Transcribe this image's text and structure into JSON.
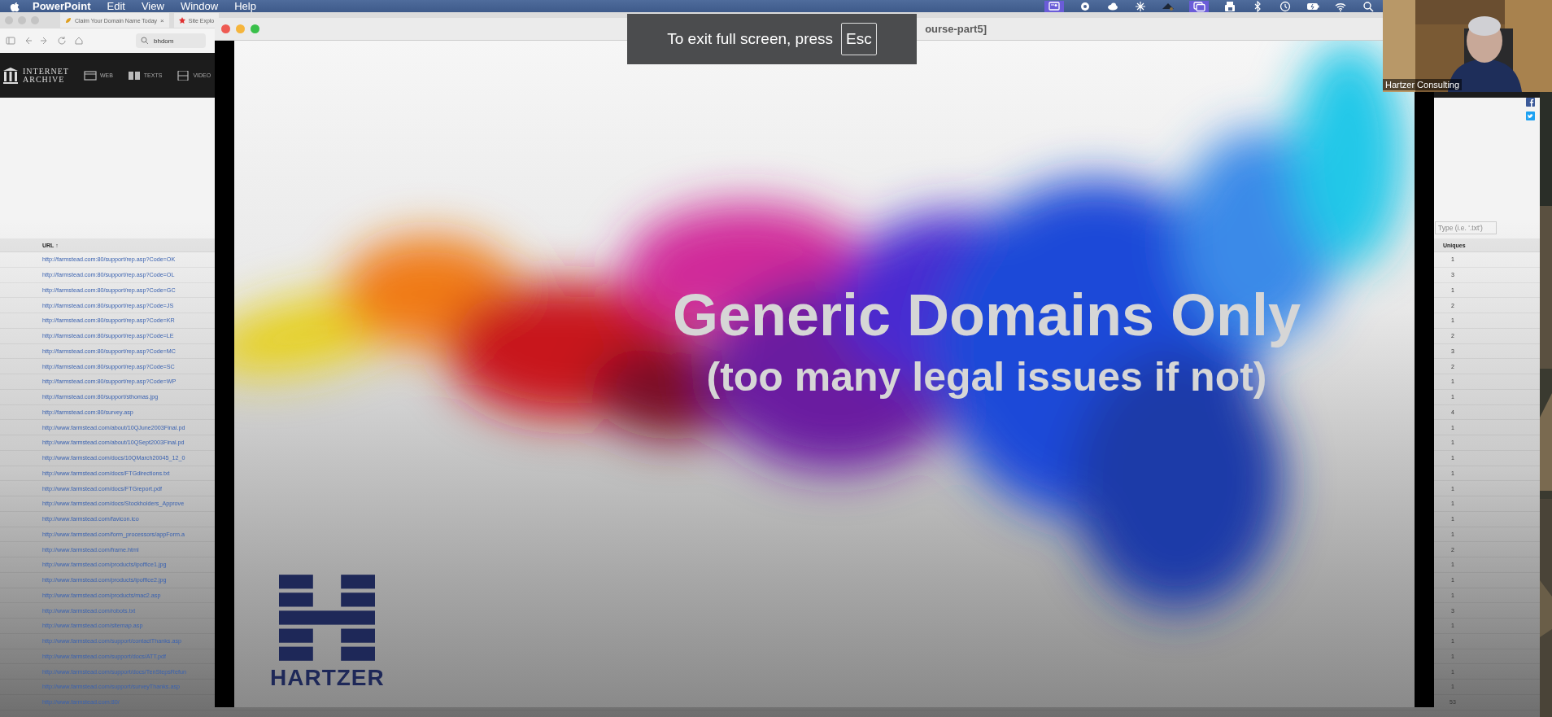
{
  "menu_bar": {
    "app": "PowerPoint",
    "items": [
      "Edit",
      "View",
      "Window",
      "Help"
    ]
  },
  "browser": {
    "tabs": [
      {
        "label": "Claim Your Domain Name Today",
        "close": "×"
      },
      {
        "label": "Site Explo"
      }
    ],
    "address": "bhdom",
    "site_header": {
      "logo_lines": [
        "INTERNET",
        "ARCHIVE"
      ],
      "links": [
        "WEB",
        "TEXTS",
        "VIDEO"
      ]
    },
    "filter_field": {
      "placeholder": "Type (i.e. '.txt')"
    },
    "table": {
      "columns": [
        "URL ↑",
        "Uniques"
      ],
      "rows": [
        {
          "url": "http://farmstead.com:80/support/rep.asp?Code=OK",
          "uniques": "1"
        },
        {
          "url": "http://farmstead.com:80/support/rep.asp?Code=OL",
          "uniques": "3"
        },
        {
          "url": "http://farmstead.com:80/support/rep.asp?Code=GC",
          "uniques": "1"
        },
        {
          "url": "http://farmstead.com:80/support/rep.asp?Code=JS",
          "uniques": "2"
        },
        {
          "url": "http://farmstead.com:80/support/rep.asp?Code=KR",
          "uniques": "1"
        },
        {
          "url": "http://farmstead.com:80/support/rep.asp?Code=LE",
          "uniques": "2"
        },
        {
          "url": "http://farmstead.com:80/support/rep.asp?Code=MC",
          "uniques": "3"
        },
        {
          "url": "http://farmstead.com:80/support/rep.asp?Code=SC",
          "uniques": "2"
        },
        {
          "url": "http://farmstead.com:80/support/rep.asp?Code=WP",
          "uniques": "1"
        },
        {
          "url": "http://farmstead.com:80/support/sthomas.jpg",
          "uniques": "1"
        },
        {
          "url": "http://farmstead.com:80/survey.asp",
          "uniques": "4"
        },
        {
          "url": "http://www.farmstead.com/about/10QJune2003Final.pd",
          "uniques": "1"
        },
        {
          "url": "http://www.farmstead.com/about/10QSept2003Final.pd",
          "uniques": "1"
        },
        {
          "url": "http://www.farmstead.com/docs/10QMarch20045_12_0",
          "uniques": "1"
        },
        {
          "url": "http://www.farmstead.com/docs/FTGdirections.txt",
          "uniques": "1"
        },
        {
          "url": "http://www.farmstead.com/docs/FTGreport.pdf",
          "uniques": "1"
        },
        {
          "url": "http://www.farmstead.com/docs/Stockholders_Approve",
          "uniques": "1"
        },
        {
          "url": "http://www.farmstead.com/favicon.ico",
          "uniques": "1"
        },
        {
          "url": "http://www.farmstead.com/form_processors/appForm.a",
          "uniques": "1"
        },
        {
          "url": "http://www.farmstead.com/frame.html",
          "uniques": "2"
        },
        {
          "url": "http://www.farmstead.com/products/ipoffice1.jpg",
          "uniques": "1"
        },
        {
          "url": "http://www.farmstead.com/products/ipoffice2.jpg",
          "uniques": "1"
        },
        {
          "url": "http://www.farmstead.com/products/mac2.asp",
          "uniques": "1"
        },
        {
          "url": "http://www.farmstead.com/robots.txt",
          "uniques": "3"
        },
        {
          "url": "http://www.farmstead.com/sitemap.asp",
          "uniques": "1"
        },
        {
          "url": "http://www.farmstead.com/support/contactThanks.asp",
          "uniques": "1"
        },
        {
          "url": "http://www.farmstead.com/support/docs/ATT.pdf",
          "uniques": "1"
        },
        {
          "url": "http://www.farmstead.com/support/docs/TenStepsRefun",
          "uniques": "1"
        },
        {
          "url": "http://www.farmstead.com/support/surveyThanks.asp",
          "uniques": "1"
        },
        {
          "url": "http://www.farmstead.com:80/",
          "uniques": "53"
        }
      ]
    }
  },
  "slideshow_window": {
    "title": "ourse-part5]",
    "slide": {
      "title": "Generic Domains Only",
      "subtitle": "(too many legal issues if not)",
      "logo_text": "HARTZER"
    }
  },
  "fullscreen_notice": {
    "text": "To exit full screen, press",
    "key": "Esc"
  },
  "video_tile": {
    "name": "Hartzer Consulting"
  }
}
